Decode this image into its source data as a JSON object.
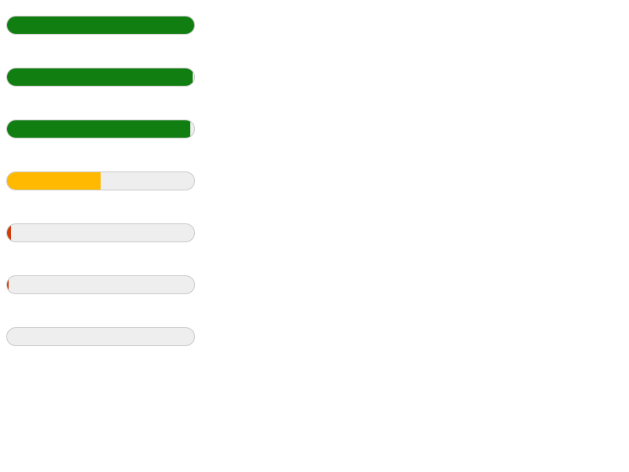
{
  "colors": {
    "high": "#117e11",
    "medium": "#ffb900",
    "low": "#d23c0a",
    "track": "#eeeeee"
  },
  "progress_bars": [
    {
      "value": 100,
      "level": "high"
    },
    {
      "value": 99,
      "level": "high"
    },
    {
      "value": 98,
      "level": "high"
    },
    {
      "value": 50,
      "level": "medium"
    },
    {
      "value": 2,
      "level": "low"
    },
    {
      "value": 1,
      "level": "low"
    },
    {
      "value": 0,
      "level": "low"
    }
  ]
}
